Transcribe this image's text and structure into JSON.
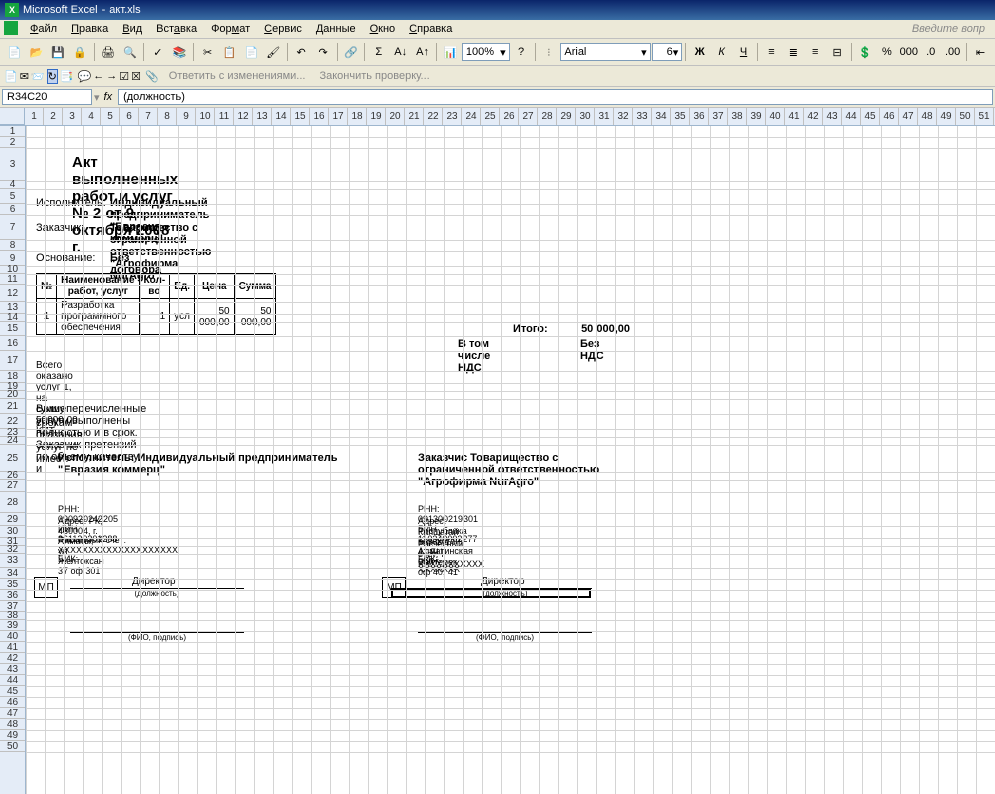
{
  "titlebar": {
    "app": "Microsoft Excel",
    "file": "акт.xls"
  },
  "menu": {
    "file": "Файл",
    "edit": "Правка",
    "view": "Вид",
    "insert": "Вставка",
    "format": "Формат",
    "tools": "Сервис",
    "data": "Данные",
    "window": "Окно",
    "help": "Справка",
    "prompt": "Введите вопр"
  },
  "toolbar": {
    "zoom": "100%",
    "font": "Arial",
    "size": "6"
  },
  "review": {
    "reply": "Ответить с изменениями...",
    "end": "Закончить проверку..."
  },
  "namebox": "R34C20",
  "fx": "fx",
  "formula": "(должность)",
  "columns": [
    "1",
    "2",
    "3",
    "4",
    "5",
    "6",
    "7",
    "8",
    "9",
    "10",
    "11",
    "12",
    "13",
    "14",
    "15",
    "16",
    "17",
    "18",
    "19",
    "20",
    "21",
    "22",
    "23",
    "24",
    "25",
    "26",
    "27",
    "28",
    "29",
    "30",
    "31",
    "32",
    "33",
    "34",
    "35",
    "36",
    "37",
    "38",
    "39",
    "40",
    "41",
    "42",
    "43",
    "44",
    "45",
    "46",
    "47",
    "48",
    "49",
    "50",
    "51"
  ],
  "rows": [
    "1",
    "2",
    "3",
    "4",
    "5",
    "6",
    "7",
    "8",
    "9",
    "10",
    "11",
    "12",
    "13",
    "14",
    "15",
    "16",
    "17",
    "18",
    "19",
    "20",
    "21",
    "22",
    "23",
    "24",
    "25",
    "26",
    "27",
    "28",
    "29",
    "30",
    "31",
    "32",
    "33",
    "34",
    "35",
    "36",
    "37",
    "38",
    "39",
    "40",
    "41",
    "42",
    "43",
    "44",
    "45",
    "46",
    "47",
    "48",
    "49",
    "50"
  ],
  "doc": {
    "title": "Акт выполненных работ и услуг    № 2 от 9 октября 2008 г.",
    "executor_lbl": "Исполнитель:",
    "executor": "Индивидуальный предприниматель \"Евразия коммерц\"",
    "customer_lbl": "Заказчик:",
    "customer": "Товарищество с ограниченной ответственностью \"Агрофирма NurAgro\"",
    "basis_lbl": "Основание:",
    "basis": "Без договора",
    "th_no": "№",
    "th_name": "Наименование работ, услуг",
    "th_qty": "Кол-во",
    "th_unit": "Ед.",
    "th_price": "Цена",
    "th_sum": "Сумма",
    "row_no": "1",
    "row_name": "Разработка программного обеспечения",
    "row_qty": "1",
    "row_unit": "усл",
    "row_price": "50 000,00",
    "row_sum": "50 000,00",
    "total_lbl": "Итого:",
    "total": "50 000,00",
    "vat_lbl": "В том числе НДС",
    "vat": "Без НДС",
    "summary": "Всего оказано услуг 1, на сумму 50000,00 KZT",
    "disclaimer1": "Вышеперечисленные услуги выполнены полностью и в срок. Заказчик претензий по объему, качеству и",
    "disclaimer2": "срокам оказания услуг не имеет.",
    "exec_title": "Исполнитель: Индивидуальный предприниматель \"Евразия коммерц\"",
    "cust_title": "Заказчис  Товарищество с ограниченной ответственностью \"Агрофирма NurAgro\"",
    "exec_rnn": "РНН: 090920242205   ИИН 861120301288",
    "exec_addr": "Адрес: РК,  480004,  г. Алматы,    ул Желтоксан 37 оф 301",
    "exec_acct": "Расчетный счет: XXXXXXXXXXXXXXXXXXXX",
    "exec_bik": "БИК:",
    "cust_rnn": "РНН: 091300219301   БИН 110340002277",
    "cust_addr1": "Адрес: Республика Казахстан, Алматинская обл г",
    "cust_addr2": "Капшагай мкр 1 д 41  БЦ Байтерек  оф 40, 41",
    "cust_acct": "Расчетный счет: XXXXXXXXXXX",
    "cust_bik": "БИК: XXXXXXX",
    "mp": "МП",
    "director": "Директор",
    "position": "(должность)",
    "fio": "(ФИО, подпись)"
  }
}
